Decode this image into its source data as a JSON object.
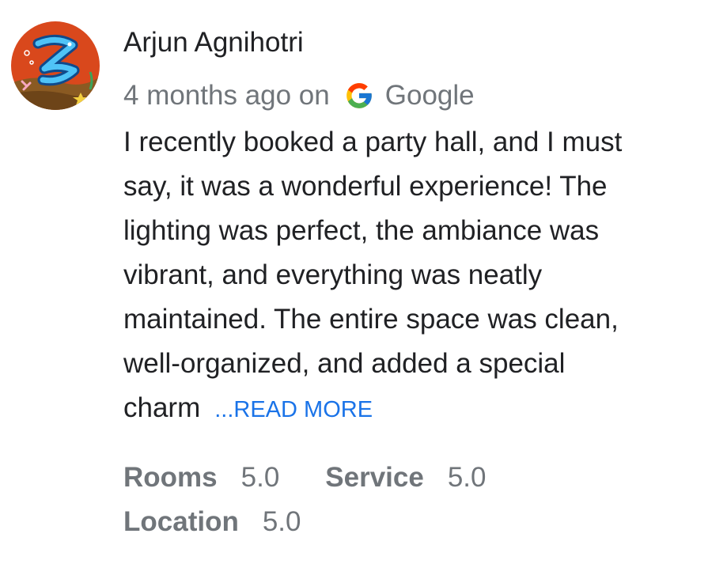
{
  "review": {
    "author_name": "Arjun Agnihotri",
    "time_ago": "4 months ago on",
    "source_name": "Google",
    "source_icon": "google-g-icon",
    "text_lines": [
      "I recently booked a party hall, and I must",
      "say, it was a wonderful experience! The",
      "lighting was perfect, the ambiance was",
      "vibrant, and everything was neatly",
      "maintained. The entire space was clean,",
      "well-organized, and added a special",
      "charm"
    ],
    "read_more_label": "...READ MORE",
    "ratings": [
      {
        "label": "Rooms",
        "value": "5.0"
      },
      {
        "label": "Service",
        "value": "5.0"
      },
      {
        "label": "Location",
        "value": "5.0"
      }
    ]
  },
  "colors": {
    "author": "#202124",
    "meta": "#70757a",
    "link": "#1a73e8",
    "avatar_bg": "#d9481c"
  }
}
